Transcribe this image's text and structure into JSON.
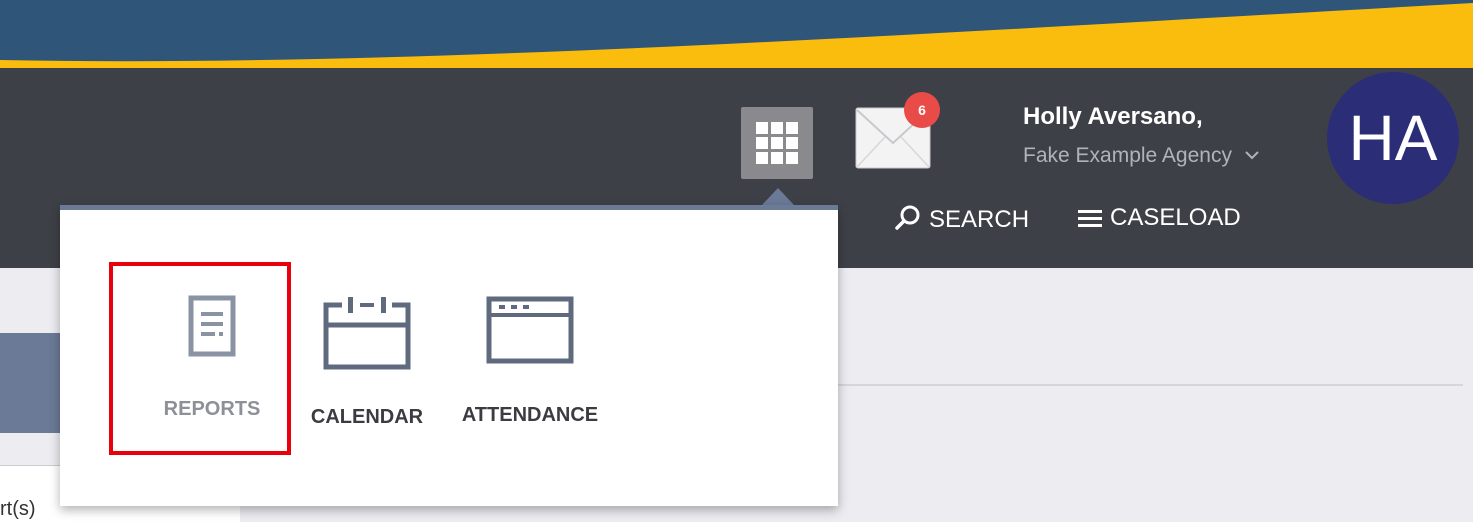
{
  "header": {
    "mail_badge_count": "6",
    "user_name": "Holly Aversano,",
    "agency_name": "Fake Example Agency",
    "avatar_initials": "HA",
    "search_label": "SEARCH",
    "caseload_label": "CASELOAD"
  },
  "apps_menu": {
    "items": [
      {
        "label": "REPORTS",
        "icon": "document-icon"
      },
      {
        "label": "CALENDAR",
        "icon": "calendar-icon"
      },
      {
        "label": "ATTENDANCE",
        "icon": "browser-window-icon"
      }
    ]
  },
  "background": {
    "partial_text": "rt(s)"
  },
  "colors": {
    "topbar": "#3e4047",
    "accent_slate": "#6b7a97",
    "badge": "#e94b48",
    "avatar": "#2b2d77",
    "highlight": "#e8000d",
    "banner_yellow": "#fbbd0d",
    "banner_blue": "#2f5578"
  }
}
